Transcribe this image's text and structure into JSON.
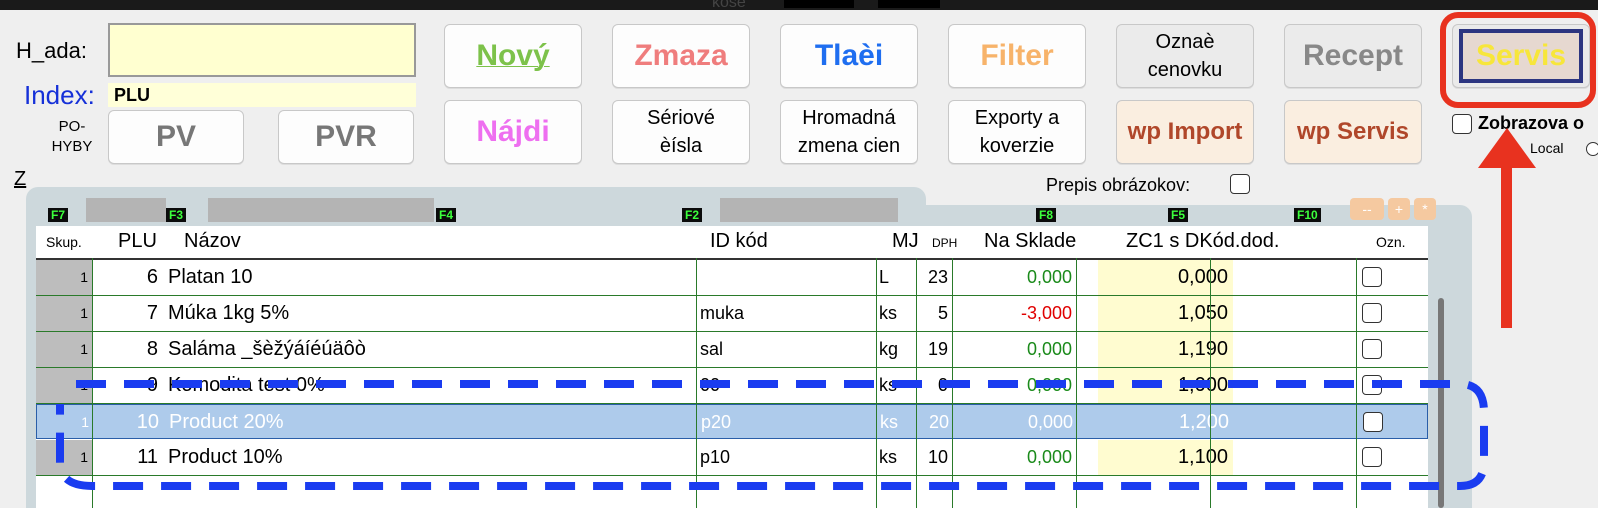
{
  "top_strip_text": "kose",
  "search": {
    "label": "H_ada:",
    "value": ""
  },
  "index": {
    "label": "Index:",
    "value": "PLU"
  },
  "pohyby_label": "PO-\nHYBY",
  "z_label": "Z",
  "buttons": {
    "pv": "PV",
    "pvr": "PVR",
    "novy": "Nový",
    "zmaza": "Zmaza",
    "tlaci": "Tlaèi",
    "filter": "Filter",
    "oznac_cenovku": "Oznaè\ncenovku",
    "recept": "Recept",
    "servis": "Servis",
    "najdi": "Nájdi",
    "seriove_cisla": "Sériové\nèísla",
    "hromadna": "Hromadná\nzmena cien",
    "exporty": "Exporty a\nkoverzie",
    "wp_import": "wp Import",
    "wp_servis": "wp Servis"
  },
  "zobrazova_label": "Zobrazova o",
  "local_label": "Local",
  "prepis_label": "Prepis obrázokov:",
  "fkeys": [
    "F7",
    "F3",
    "F4",
    "F2",
    "F8",
    "F5",
    "F10"
  ],
  "mini_buttons": [
    "--",
    "+",
    "*"
  ],
  "columns": [
    "Skup.",
    "PLU",
    "Názov",
    "ID kód",
    "MJ",
    "DPH",
    "Na Sklade",
    "ZC1 s DKód.dod.",
    "Ozn."
  ],
  "rows": [
    {
      "skup": "1",
      "plu": "6",
      "nazov": "Platan 10",
      "id": "",
      "mj": "L",
      "dph": "23",
      "sklad": "0,000",
      "zc": "0,000"
    },
    {
      "skup": "1",
      "plu": "7",
      "nazov": "Múka 1kg 5%",
      "id": "muka",
      "mj": "ks",
      "dph": "5",
      "sklad": "-3,000",
      "zc": "1,050"
    },
    {
      "skup": "1",
      "plu": "8",
      "nazov": "Saláma _šèžýáíéúäôò",
      "id": "sal",
      "mj": "kg",
      "dph": "19",
      "sklad": "0,000",
      "zc": "1,190"
    },
    {
      "skup": "1",
      "plu": "9",
      "nazov": "Komodita test 0%",
      "id": "00",
      "mj": "ks",
      "dph": "0",
      "sklad": "0,000",
      "zc": "1,000"
    },
    {
      "skup": "1",
      "plu": "10",
      "nazov": "Product 20%",
      "id": "p20",
      "mj": "ks",
      "dph": "20",
      "sklad": "0,000",
      "zc": "1,200"
    },
    {
      "skup": "1",
      "plu": "11",
      "nazov": "Product 10%",
      "id": "p10",
      "mj": "ks",
      "dph": "10",
      "sklad": "0,000",
      "zc": "1,100"
    }
  ],
  "colors": {
    "accent_red": "#e8321f",
    "selection": "#aecbeb",
    "dash_blue": "#1a3cf0",
    "green_text": "#1a8a1a",
    "red_text": "#e00000"
  }
}
